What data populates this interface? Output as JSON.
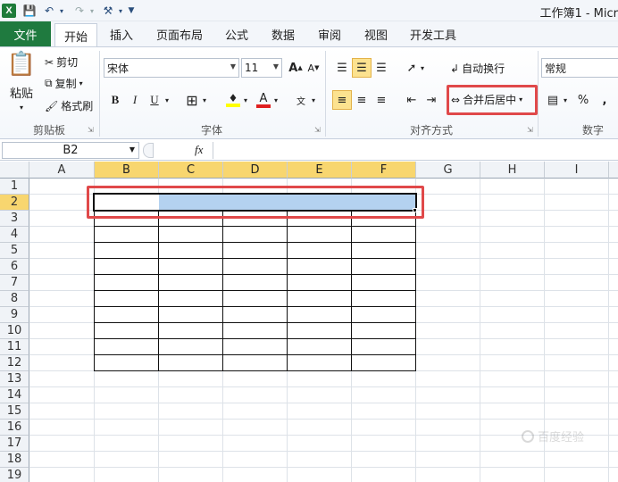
{
  "window": {
    "title": "工作簿1 - Micr"
  },
  "ribbon_tabs": [
    "文件",
    "开始",
    "插入",
    "页面布局",
    "公式",
    "数据",
    "审阅",
    "视图",
    "开发工具"
  ],
  "clipboard": {
    "paste": "粘贴",
    "cut": "剪切",
    "copy": "复制",
    "format_painter": "格式刷",
    "label": "剪贴板"
  },
  "font": {
    "name": "宋体",
    "size": "11",
    "bold": "B",
    "italic": "I",
    "underline": "U",
    "label": "字体"
  },
  "alignment": {
    "wrap_text": "自动换行",
    "merge_center": "合并后居中",
    "label": "对齐方式"
  },
  "number": {
    "format": "常规",
    "percent": "%",
    "comma": ",",
    "label": "数字"
  },
  "formula_bar": {
    "name_box": "B2",
    "fx": "fx"
  },
  "sheet": {
    "columns": [
      "A",
      "B",
      "C",
      "D",
      "E",
      "F",
      "G",
      "H",
      "I"
    ],
    "rows": [
      "1",
      "2",
      "3",
      "4",
      "5",
      "6",
      "7",
      "8",
      "9",
      "10",
      "11",
      "12",
      "13",
      "14",
      "15",
      "16",
      "17",
      "18",
      "19"
    ],
    "selection": "B2:F2",
    "bordered_range": "B2:F12"
  },
  "colors": {
    "file_tab": "#1f7a3f",
    "highlight": "#e0494a",
    "selection": "#b4d2f0",
    "header_selected": "#f8d66f"
  },
  "watermark": "百度经验"
}
